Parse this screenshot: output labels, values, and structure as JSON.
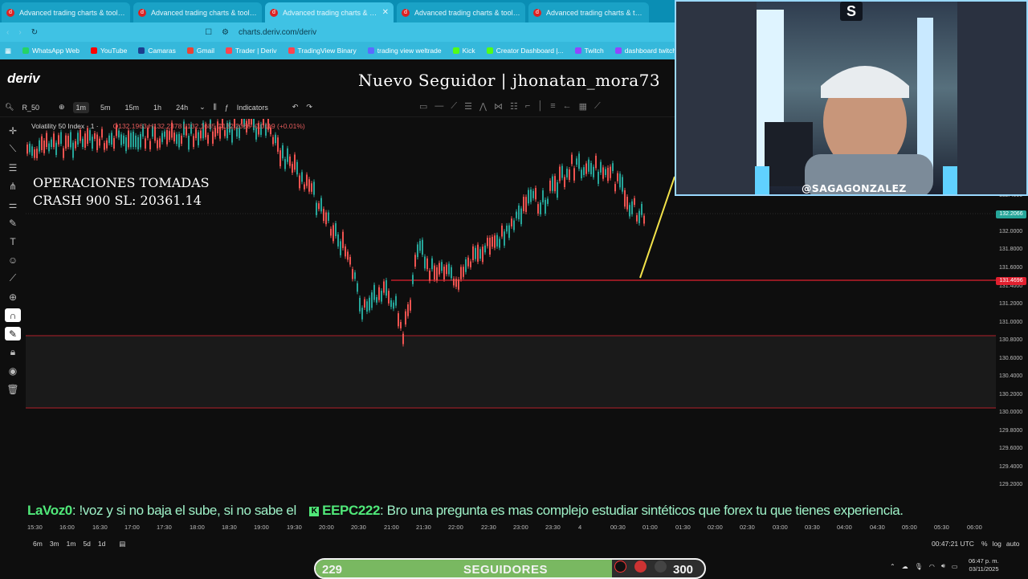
{
  "browser": {
    "tabs": [
      {
        "title": "Advanced trading charts & tools | Tr",
        "active": false
      },
      {
        "title": "Advanced trading charts & tools | Tr",
        "active": false
      },
      {
        "title": "Advanced trading charts & tools",
        "active": true
      },
      {
        "title": "Advanced trading charts & tools | Tr",
        "active": false
      },
      {
        "title": "Advanced trading charts & tools | Tr",
        "active": false
      }
    ],
    "url": "charts.deriv.com/deriv",
    "bookmarks": [
      "WhatsApp Web",
      "YouTube",
      "Camaras",
      "Gmail",
      "Trader | Deriv",
      "TradingView Binary",
      "trading view weltrade",
      "Kick",
      "Creator Dashboard |...",
      "Twitch",
      "dashboard twitch"
    ]
  },
  "app": {
    "logo": "deriv",
    "overlay_follower": "Nuevo Seguidor | jhonatan_mora73"
  },
  "toolbar": {
    "symbol": "R_50",
    "timeframes": [
      "1m",
      "5m",
      "15m",
      "1h",
      "24h"
    ],
    "selected_timeframe": "1m",
    "indicators_label": "Indicators"
  },
  "legend": {
    "instrument": "Volatility 50 Index · 1 ·",
    "open": "O132.1963",
    "high": "H132.2378",
    "low": "L132.1685",
    "close": "C132.2066 -0.0119 (+0.01%)"
  },
  "annotation": {
    "line1": "OPERACIONES TOMADAS",
    "line2": "CRASH 900 SL: 20361.14"
  },
  "price_scale": [
    "132.4000",
    "132.0000",
    "131.8000",
    "131.6000",
    "131.4000",
    "131.2000",
    "131.0000",
    "130.8000",
    "130.6000",
    "130.4000",
    "130.2000",
    "130.0000",
    "129.8000",
    "129.6000",
    "129.4000",
    "129.2000"
  ],
  "price_tags": {
    "current": "132.2066",
    "line": "131.4696"
  },
  "time_axis": [
    "15:30",
    "16:00",
    "16:30",
    "17:00",
    "17:30",
    "18:00",
    "18:30",
    "19:00",
    "19:30",
    "20:00",
    "20:30",
    "21:00",
    "21:30",
    "22:00",
    "22:30",
    "23:00",
    "23:30",
    "4",
    "00:30",
    "01:00",
    "01:30",
    "02:00",
    "02:30",
    "03:00",
    "03:30",
    "04:00",
    "04:30",
    "05:00",
    "05:30",
    "06:00"
  ],
  "ranges": [
    "6m",
    "3m",
    "1m",
    "5d",
    "1d"
  ],
  "utc_clock": "00:47:21 UTC",
  "scale_options": [
    "%",
    "log",
    "auto"
  ],
  "chat": {
    "msg1_user": "LaVoz0",
    "msg1_text": ": !voz y si no baja el sube, si no sabe el",
    "msg2_user": "EEPC222",
    "msg2_text": ": Bro una pregunta es mas complejo estudiar sintéticos que forex tu que tienes experiencia."
  },
  "webcam": {
    "handle": "@SAGAGONZALEZ",
    "logo": "S"
  },
  "goal": {
    "current": 229,
    "target": 300,
    "label": "SEGUIDORES",
    "progress": 0.763
  },
  "system": {
    "time": "06:47 p. m.",
    "date": "03/11/2025"
  },
  "colors": {
    "bull": "#26a69a",
    "bear": "#ef5350",
    "level_line": "#e0202f",
    "trend_line": "#f2e24a",
    "accent": "#3fc2e4"
  }
}
